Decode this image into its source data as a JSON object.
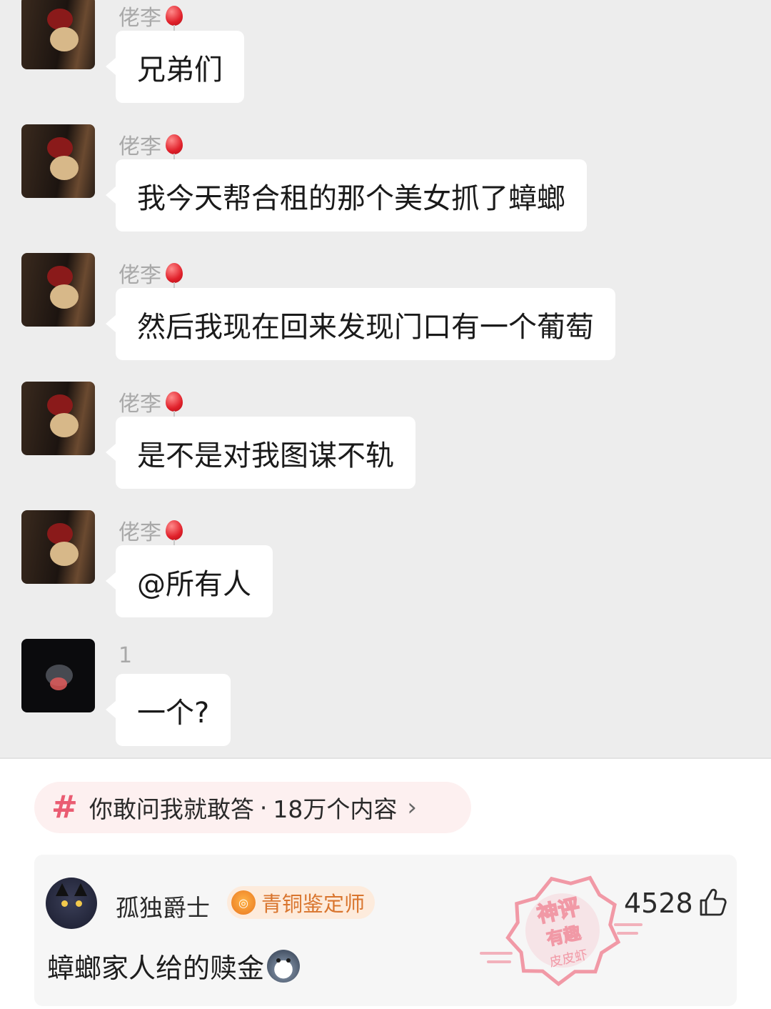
{
  "chat": {
    "messages": [
      {
        "sender": "佬李",
        "text": "兄弟们"
      },
      {
        "sender": "佬李",
        "text": "我今天帮合租的那个美女抓了蟑螂"
      },
      {
        "sender": "佬李",
        "text": "然后我现在回来发现门口有一个葡萄"
      },
      {
        "sender": "佬李",
        "text": "是不是对我图谋不轨"
      },
      {
        "sender": "佬李",
        "text": "@所有人"
      },
      {
        "sender": "1",
        "text": "一个?"
      }
    ]
  },
  "topic": {
    "hash": "#",
    "title": "你敢问我就敢答",
    "separator": "·",
    "count": "18万个内容",
    "chevron": "›"
  },
  "comment": {
    "username": "孤独爵士",
    "badge": "青铜鉴定师",
    "likes": "4528",
    "text": "蟑螂家人给的赎金"
  },
  "stamp": {
    "line1": "神评",
    "line2": "有趣",
    "line3": "皮皮虾",
    "color": "#f07a8c"
  },
  "icons": {
    "balloon": "balloon-icon",
    "thumb": "thumbs-up-icon",
    "medal": "medal-icon",
    "dog_emoji": "dog-emoji-icon"
  }
}
